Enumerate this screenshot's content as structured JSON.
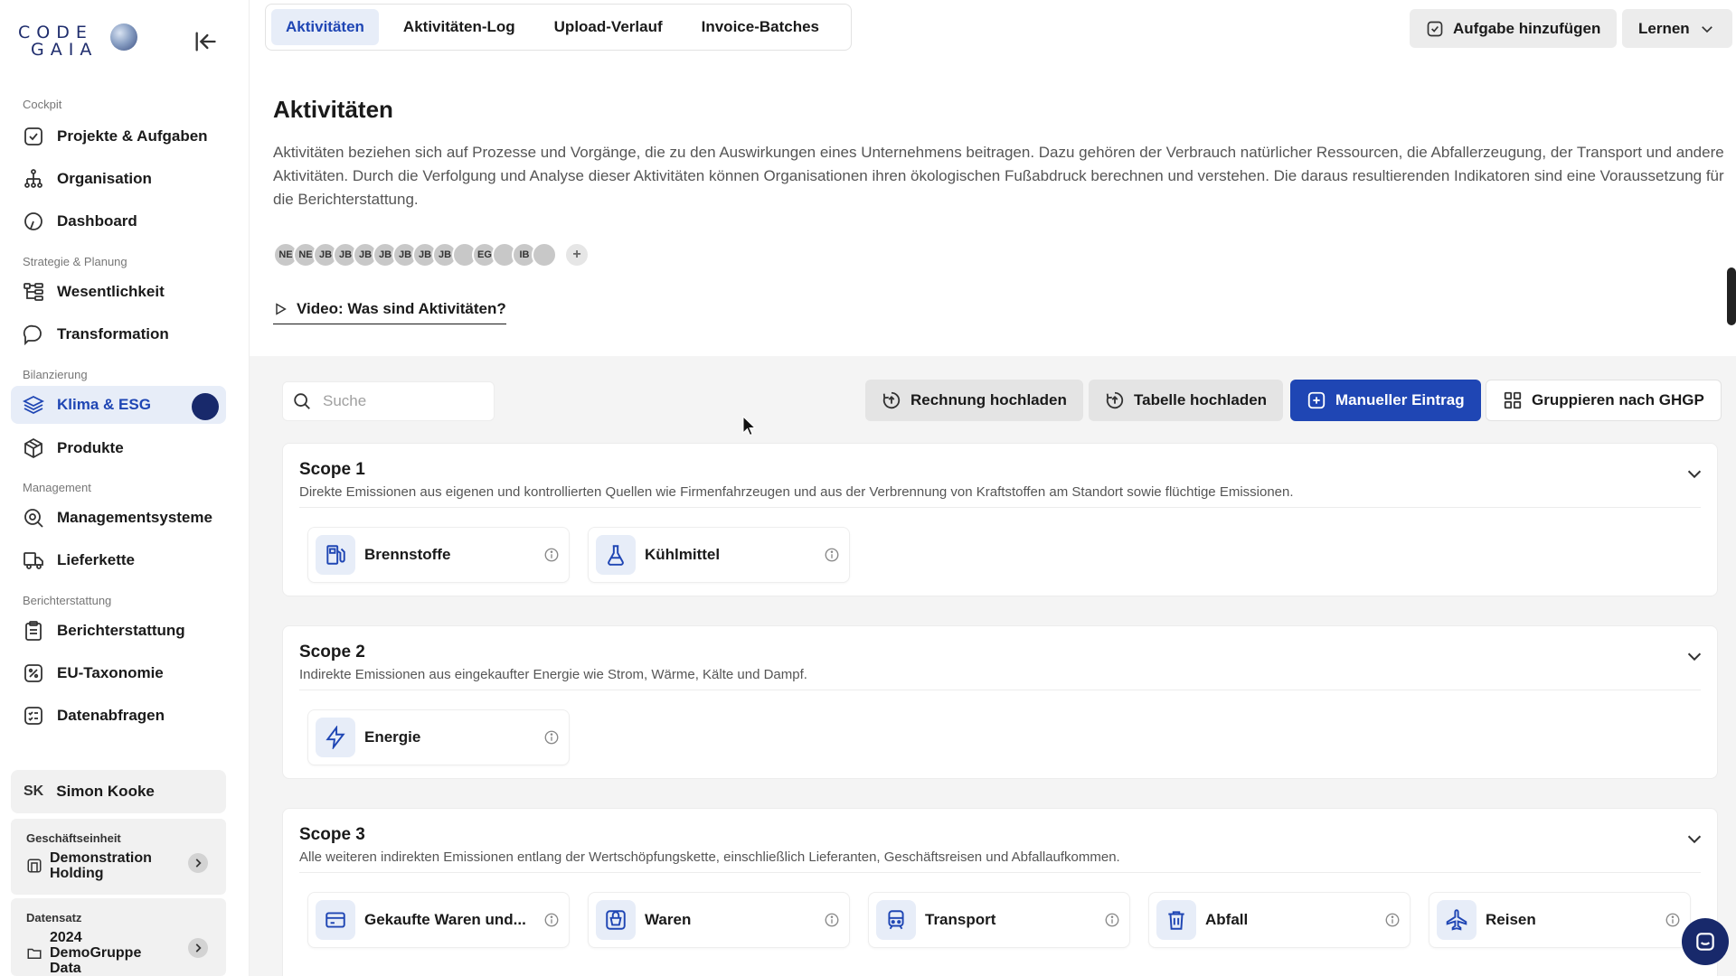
{
  "brand": {
    "logo_line1": "CODE",
    "logo_line2": "GAIA"
  },
  "sidebar": {
    "sections": [
      {
        "label": "Cockpit",
        "items": [
          {
            "label": "Projekte & Aufgaben",
            "icon": "check-square-icon"
          },
          {
            "label": "Organisation",
            "icon": "hierarchy-icon"
          },
          {
            "label": "Dashboard",
            "icon": "gauge-icon"
          }
        ]
      },
      {
        "label": "Strategie & Planung",
        "items": [
          {
            "label": "Wesentlichkeit",
            "icon": "tree-icon"
          },
          {
            "label": "Transformation",
            "icon": "chat-icon"
          }
        ]
      },
      {
        "label": "Bilanzierung",
        "items": [
          {
            "label": "Klima & ESG",
            "icon": "layers-icon",
            "active": true
          },
          {
            "label": "Produkte",
            "icon": "box-icon"
          }
        ]
      },
      {
        "label": "Management",
        "items": [
          {
            "label": "Managementsysteme",
            "icon": "search-gear-icon"
          },
          {
            "label": "Lieferkette",
            "icon": "truck-icon"
          }
        ]
      },
      {
        "label": "Berichterstattung",
        "items": [
          {
            "label": "Berichterstattung",
            "icon": "clipboard-icon"
          },
          {
            "label": "EU-Taxonomie",
            "icon": "percent-icon"
          },
          {
            "label": "Datenabfragen",
            "icon": "list-icon"
          }
        ]
      }
    ],
    "user": {
      "initials": "SK",
      "name": "Simon Kooke"
    },
    "business_unit": {
      "label": "Geschäftseinheit",
      "value": "Demonstration Holding"
    },
    "dataset": {
      "label": "Datensatz",
      "value": "2024 DemoGruppe Data"
    }
  },
  "tabs": [
    {
      "label": "Aktivitäten",
      "active": true
    },
    {
      "label": "Aktivitäten-Log"
    },
    {
      "label": "Upload-Verlauf"
    },
    {
      "label": "Invoice-Batches"
    }
  ],
  "header": {
    "add_task": "Aufgabe hinzufügen",
    "learn": "Lernen"
  },
  "intro": {
    "title": "Aktivitäten",
    "description": "Aktivitäten beziehen sich auf Prozesse und Vorgänge, die zu den Auswirkungen eines Unternehmens beitragen. Dazu gehören der Verbrauch natürlicher Ressourcen, die Abfallerzeugung, der Transport und andere Aktivitäten. Durch die Verfolgung und Analyse dieser Aktivitäten können Organisationen ihren ökologischen Fußabdruck berechnen und verstehen. Die daraus resultierenden Indikatoren sind eine Voraussetzung für die Berichterstattung.",
    "avatars": [
      "NE",
      "NE",
      "JB",
      "JB",
      "JB",
      "JB",
      "JB",
      "JB",
      "JB",
      "",
      "EG",
      "",
      "IB",
      ""
    ],
    "add_avatar": "+",
    "video_link": "Video: Was sind Aktivitäten?"
  },
  "toolbar": {
    "search_placeholder": "Suche",
    "upload_invoice": "Rechnung hochladen",
    "upload_table": "Tabelle hochladen",
    "manual_entry": "Manueller Eintrag",
    "group_ghgp": "Gruppieren nach GHGP"
  },
  "scopes": [
    {
      "title": "Scope 1",
      "description": "Direkte Emissionen aus eigenen und kontrollierten Quellen wie Firmenfahrzeugen und aus der Verbrennung von Kraftstoffen am Standort sowie flüchtige Emissionen.",
      "categories": [
        {
          "label": "Brennstoffe",
          "icon": "fuel-pump-icon"
        },
        {
          "label": "Kühlmittel",
          "icon": "flask-icon"
        }
      ]
    },
    {
      "title": "Scope 2",
      "description": "Indirekte Emissionen aus eingekaufter Energie wie Strom, Wärme, Kälte und Dampf.",
      "categories": [
        {
          "label": "Energie",
          "icon": "lightning-icon"
        }
      ]
    },
    {
      "title": "Scope 3",
      "description": "Alle weiteren indirekten Emissionen entlang der Wertschöpfungskette, einschließlich Lieferanten, Geschäftsreisen und Abfallaufkommen.",
      "categories": [
        {
          "label": "Gekaufte Waren und...",
          "icon": "card-icon"
        },
        {
          "label": "Waren",
          "icon": "basket-icon"
        },
        {
          "label": "Transport",
          "icon": "train-icon"
        },
        {
          "label": "Abfall",
          "icon": "trash-icon"
        },
        {
          "label": "Reisen",
          "icon": "plane-icon"
        }
      ]
    }
  ],
  "colors": {
    "accent": "#1f46b4",
    "accent_light": "#e7edf8",
    "navy": "#18296b",
    "page_bg": "#f4f4f4"
  }
}
